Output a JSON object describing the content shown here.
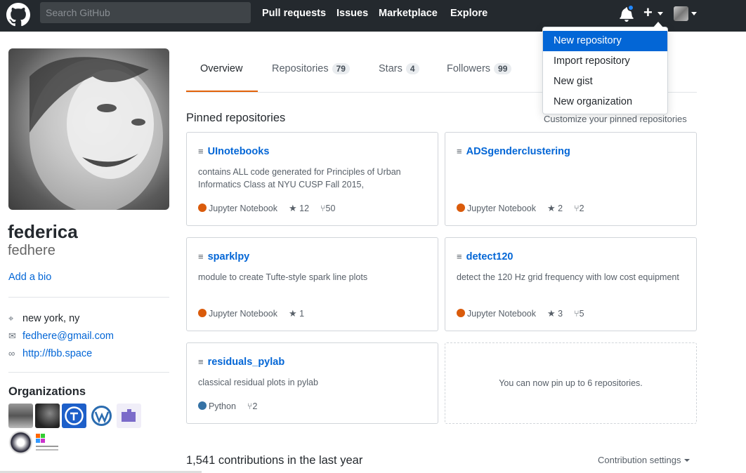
{
  "header": {
    "search_placeholder": "Search GitHub",
    "nav": [
      "Pull requests",
      "Issues",
      "Marketplace",
      "Explore"
    ],
    "plus_symbol": "+"
  },
  "dropdown": {
    "items": [
      "New repository",
      "Import repository",
      "New gist",
      "New organization"
    ],
    "active_index": 0
  },
  "profile": {
    "name": "federica",
    "login": "fedhere",
    "bio_link": "Add a bio",
    "location": "new york, ny",
    "email": "fedhere@gmail.com",
    "website": "http://fbb.space",
    "organizations_title": "Organizations"
  },
  "tabs": [
    {
      "label": "Overview",
      "count": null
    },
    {
      "label": "Repositories",
      "count": "79"
    },
    {
      "label": "Stars",
      "count": "4"
    },
    {
      "label": "Followers",
      "count": "99"
    }
  ],
  "pinned": {
    "title": "Pinned repositories",
    "customize": "Customize your pinned repositories",
    "repos": [
      {
        "name": "UInotebooks",
        "desc": "contains ALL code generated for Principles of Urban Informatics Class at NYU CUSP Fall 2015,",
        "language": "Jupyter Notebook",
        "lang_color": "#DA5B0B",
        "stars": "12",
        "forks": "50"
      },
      {
        "name": "ADSgenderclustering",
        "desc": "",
        "language": "Jupyter Notebook",
        "lang_color": "#DA5B0B",
        "stars": "2",
        "forks": "2"
      },
      {
        "name": "sparklpy",
        "desc": "module to create Tufte-style spark line plots",
        "language": "Jupyter Notebook",
        "lang_color": "#DA5B0B",
        "stars": "1",
        "forks": ""
      },
      {
        "name": "detect120",
        "desc": "detect the 120 Hz grid frequency with low cost equipment",
        "language": "Jupyter Notebook",
        "lang_color": "#DA5B0B",
        "stars": "3",
        "forks": "5"
      },
      {
        "name": "residuals_pylab",
        "desc": "classical residual plots in pylab",
        "language": "Python",
        "lang_color": "#3572A5",
        "stars": "",
        "forks": "2"
      }
    ],
    "empty_text": "You can now pin up to 6 repositories."
  },
  "contributions": {
    "title": "1,541 contributions in the last year",
    "settings": "Contribution settings"
  },
  "colors": {
    "header_bg": "#24292e",
    "link": "#0366d6",
    "tab_accent": "#e36209",
    "notification": "#2188ff"
  }
}
